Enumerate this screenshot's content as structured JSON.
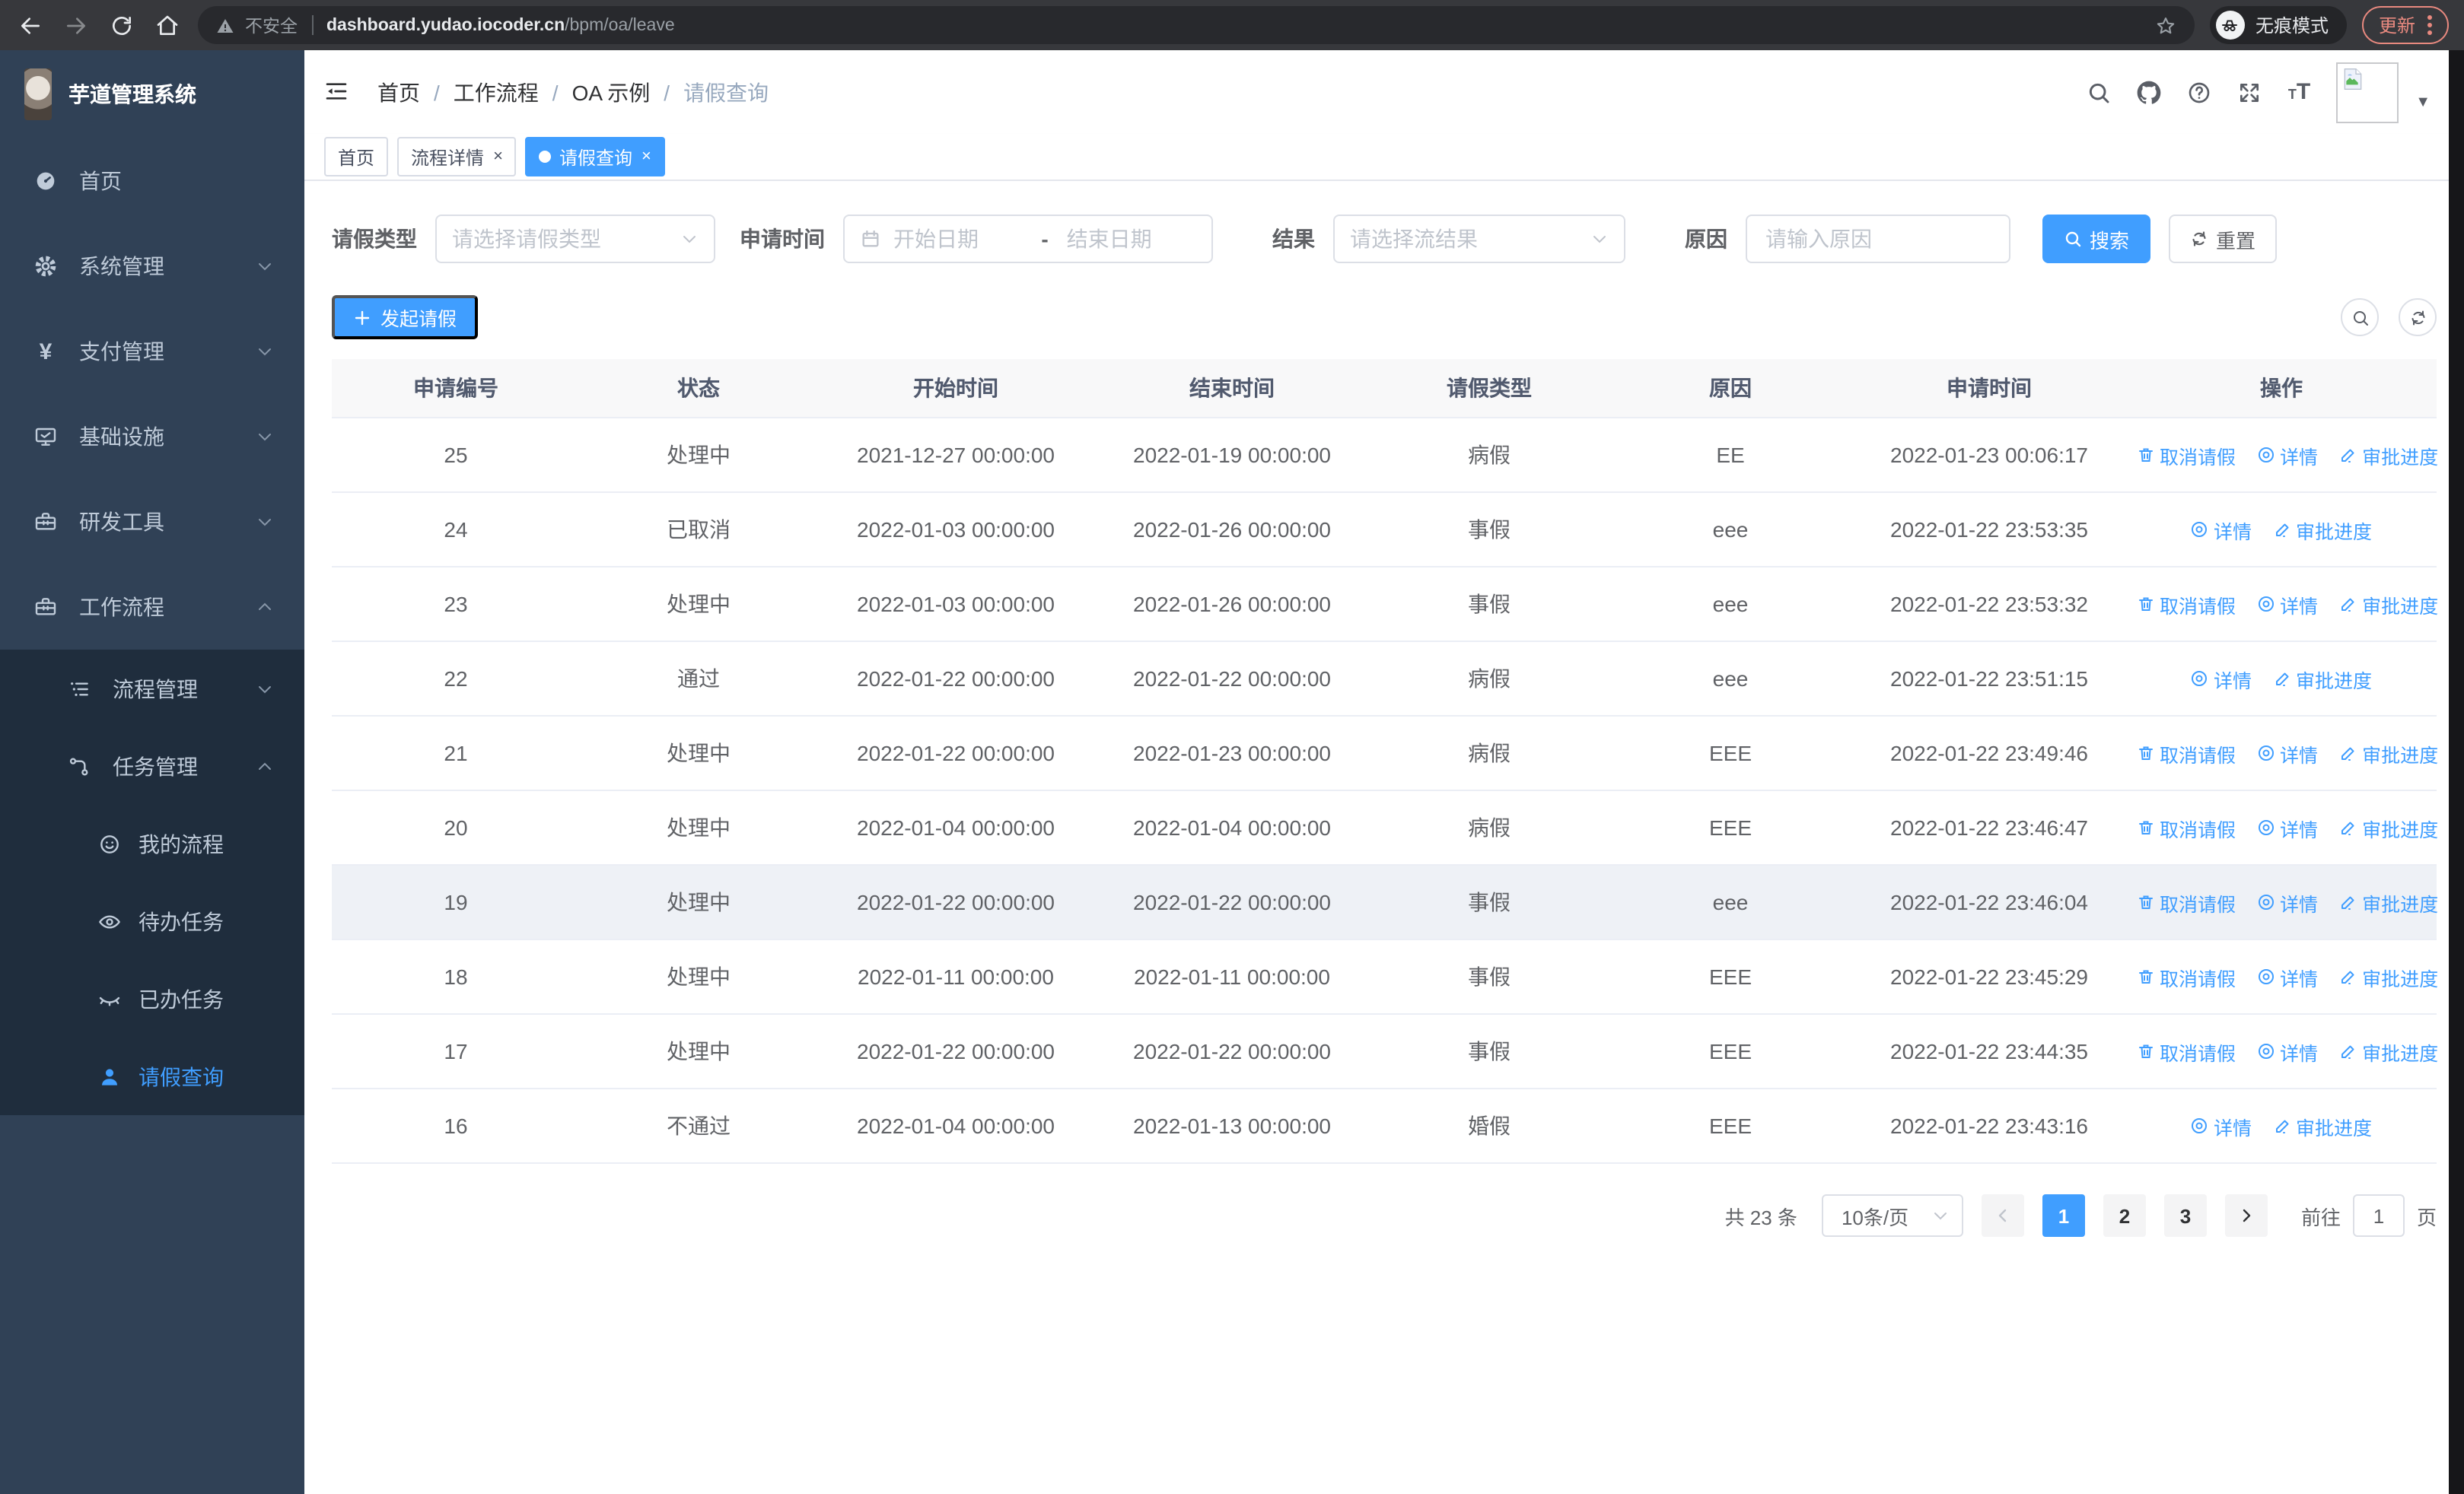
{
  "colors": {
    "accent": "#409eff",
    "sidebar_bg": "#304156",
    "submenu_bg": "#1f2d3d",
    "sidebar_text": "#bfcbd9",
    "tag_active": "#409eff"
  },
  "browser": {
    "security": "不安全",
    "url_domain": "dashboard.yudao.iocoder.cn",
    "url_path": "/bpm/oa/leave",
    "incognito_label": "无痕模式",
    "update_label": "更新"
  },
  "sidebar": {
    "title": "芋道管理系统",
    "items": [
      {
        "label": "首页",
        "icon": "gauge",
        "level": 1
      },
      {
        "label": "系统管理",
        "icon": "gear",
        "level": 1,
        "caret": "down"
      },
      {
        "label": "支付管理",
        "icon": "yen",
        "level": 1,
        "caret": "down"
      },
      {
        "label": "基础设施",
        "icon": "monitor",
        "level": 1,
        "caret": "down"
      },
      {
        "label": "研发工具",
        "icon": "toolbox",
        "level": 1,
        "caret": "down"
      },
      {
        "label": "工作流程",
        "icon": "toolbox",
        "level": 1,
        "caret": "up",
        "children": [
          {
            "label": "流程管理",
            "icon": "list",
            "level": 2,
            "caret": "down"
          },
          {
            "label": "任务管理",
            "icon": "branch",
            "level": 2,
            "caret": "up",
            "children": [
              {
                "label": "我的流程",
                "icon": "face",
                "level": 3
              },
              {
                "label": "待办任务",
                "icon": "eye-open",
                "level": 3
              },
              {
                "label": "已办任务",
                "icon": "eye-close",
                "level": 3
              },
              {
                "label": "请假查询",
                "icon": "user",
                "level": 3,
                "active": true
              }
            ]
          }
        ]
      }
    ]
  },
  "topbar": {
    "breadcrumb": [
      "首页",
      "工作流程",
      "OA 示例",
      "请假查询"
    ]
  },
  "tabs": [
    {
      "label": "首页",
      "closable": false,
      "active": false
    },
    {
      "label": "流程详情",
      "closable": true,
      "active": false
    },
    {
      "label": "请假查询",
      "closable": true,
      "active": true
    }
  ],
  "filters": {
    "leave_type": {
      "label": "请假类型",
      "placeholder": "请选择请假类型"
    },
    "apply_time": {
      "label": "申请时间",
      "start_placeholder": "开始日期",
      "range_separator": "-",
      "end_placeholder": "结束日期"
    },
    "result": {
      "label": "结果",
      "placeholder": "请选择流结果"
    },
    "reason": {
      "label": "原因",
      "placeholder": "请输入原因"
    },
    "search_label": "搜索",
    "reset_label": "重置"
  },
  "toolbar": {
    "create_label": "发起请假"
  },
  "table": {
    "headers": [
      "申请编号",
      "状态",
      "开始时间",
      "结束时间",
      "请假类型",
      "原因",
      "申请时间",
      "操作"
    ],
    "action_labels": {
      "cancel": "取消请假",
      "detail": "详情",
      "progress": "审批进度"
    },
    "rows": [
      {
        "id": "25",
        "status": "处理中",
        "start": "2021-12-27 00:00:00",
        "end": "2022-01-19 00:00:00",
        "type": "病假",
        "reason": "EE",
        "apply_time": "2022-01-23 00:06:17",
        "can_cancel": true,
        "highlight": false
      },
      {
        "id": "24",
        "status": "已取消",
        "start": "2022-01-03 00:00:00",
        "end": "2022-01-26 00:00:00",
        "type": "事假",
        "reason": "eee",
        "apply_time": "2022-01-22 23:53:35",
        "can_cancel": false,
        "highlight": false
      },
      {
        "id": "23",
        "status": "处理中",
        "start": "2022-01-03 00:00:00",
        "end": "2022-01-26 00:00:00",
        "type": "事假",
        "reason": "eee",
        "apply_time": "2022-01-22 23:53:32",
        "can_cancel": true,
        "highlight": false
      },
      {
        "id": "22",
        "status": "通过",
        "start": "2022-01-22 00:00:00",
        "end": "2022-01-22 00:00:00",
        "type": "病假",
        "reason": "eee",
        "apply_time": "2022-01-22 23:51:15",
        "can_cancel": false,
        "highlight": false
      },
      {
        "id": "21",
        "status": "处理中",
        "start": "2022-01-22 00:00:00",
        "end": "2022-01-23 00:00:00",
        "type": "病假",
        "reason": "EEE",
        "apply_time": "2022-01-22 23:49:46",
        "can_cancel": true,
        "highlight": false
      },
      {
        "id": "20",
        "status": "处理中",
        "start": "2022-01-04 00:00:00",
        "end": "2022-01-04 00:00:00",
        "type": "病假",
        "reason": "EEE",
        "apply_time": "2022-01-22 23:46:47",
        "can_cancel": true,
        "highlight": false
      },
      {
        "id": "19",
        "status": "处理中",
        "start": "2022-01-22 00:00:00",
        "end": "2022-01-22 00:00:00",
        "type": "事假",
        "reason": "eee",
        "apply_time": "2022-01-22 23:46:04",
        "can_cancel": true,
        "highlight": true
      },
      {
        "id": "18",
        "status": "处理中",
        "start": "2022-01-11 00:00:00",
        "end": "2022-01-11 00:00:00",
        "type": "事假",
        "reason": "EEE",
        "apply_time": "2022-01-22 23:45:29",
        "can_cancel": true,
        "highlight": false
      },
      {
        "id": "17",
        "status": "处理中",
        "start": "2022-01-22 00:00:00",
        "end": "2022-01-22 00:00:00",
        "type": "事假",
        "reason": "EEE",
        "apply_time": "2022-01-22 23:44:35",
        "can_cancel": true,
        "highlight": false
      },
      {
        "id": "16",
        "status": "不通过",
        "start": "2022-01-04 00:00:00",
        "end": "2022-01-13 00:00:00",
        "type": "婚假",
        "reason": "EEE",
        "apply_time": "2022-01-22 23:43:16",
        "can_cancel": false,
        "highlight": false
      }
    ]
  },
  "pagination": {
    "total_label": "共 23 条",
    "page_size_label": "10条/页",
    "pages": [
      "1",
      "2",
      "3"
    ],
    "active_page": "1",
    "goto_label": "前往",
    "goto_value": "1",
    "unit_label": "页"
  }
}
